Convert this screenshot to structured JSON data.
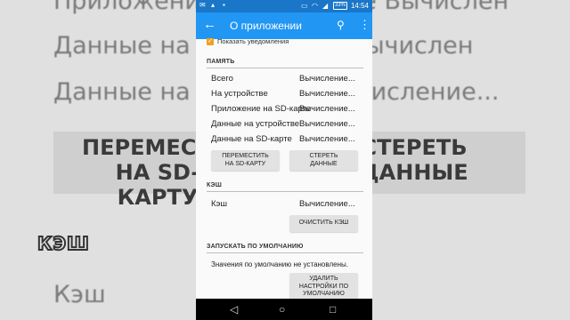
{
  "background": {
    "line1": "Приложение на SD-карте Вычислен",
    "line2": "Данные на устройстве Вычислен",
    "line3": "Данные на SD-карте Вычисление...",
    "btn_left": "ПЕРЕМЕСТИТЬ\nНА SD-КАРТУ",
    "btn_right": "СТЕРЕТЬ\nДАННЫЕ",
    "cache_heading": "КЭШ",
    "cache_row": "Кэш"
  },
  "status_bar": {
    "battery": "33%",
    "time": "14:54"
  },
  "app_bar": {
    "title": "О приложении",
    "back_icon": "←",
    "search_icon": "⚲",
    "more_icon": "⋮"
  },
  "notifications": {
    "label": "Показать уведомления",
    "checked": true
  },
  "memory": {
    "heading": "ПАМЯТЬ",
    "rows": [
      {
        "label": "Всего",
        "value": "Вычисление..."
      },
      {
        "label": "На устройстве",
        "value": "Вычисление..."
      },
      {
        "label": "Приложение на SD-карте",
        "value": "Вычисление..."
      },
      {
        "label": "Данные на устройстве",
        "value": "Вычисление..."
      },
      {
        "label": "Данные на SD-карте",
        "value": "Вычисление..."
      }
    ],
    "move_button": "ПЕРЕМЕСТИТЬ\nНА SD-КАРТУ",
    "clear_data_button": "СТЕРЕТЬ\nДАННЫЕ"
  },
  "cache": {
    "heading": "КЭШ",
    "label": "Кэш",
    "value": "Вычисление...",
    "clear_button": "ОЧИСТИТЬ КЭШ"
  },
  "defaults": {
    "heading": "ЗАПУСКАТЬ ПО УМОЛЧАНИЮ",
    "text": "Значения по умолчанию не установлены.",
    "button": "УДАЛИТЬ\nНАСТРОЙКИ ПО\nУМОЛЧАНИЮ"
  },
  "nav_bar": {
    "back": "◁",
    "home": "○",
    "recents": "□"
  },
  "colors": {
    "app_bar": "#2196f3",
    "status_bar": "#1976c8",
    "checkbox": "#f0a020"
  }
}
